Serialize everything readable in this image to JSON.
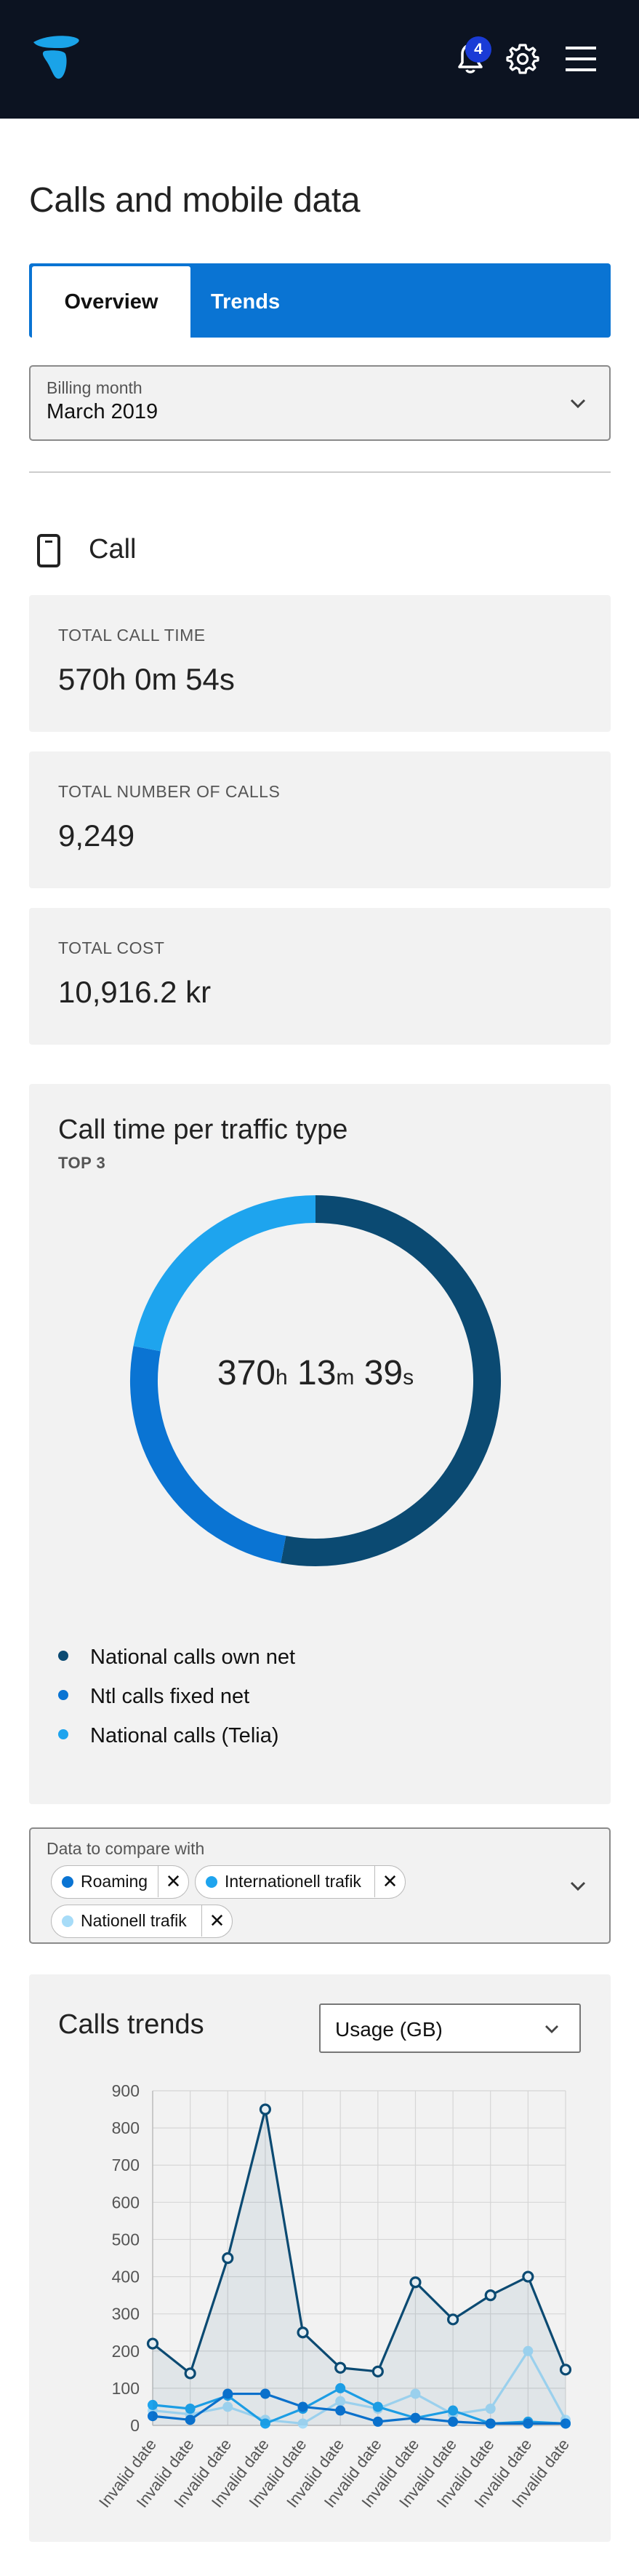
{
  "header": {
    "logo_icon": "telia-pebble-logo-icon",
    "notification_count": "4",
    "icons": [
      "bell-icon",
      "gear-icon",
      "hamburger-menu-icon"
    ],
    "colors": {
      "background": "#0c1321",
      "badge": "#1a3bd6",
      "logo": "#1aa3e8"
    }
  },
  "page": {
    "title": "Calls and mobile data"
  },
  "tabs": [
    {
      "label": "Overview",
      "active": true
    },
    {
      "label": "Trends",
      "active": false
    }
  ],
  "billing": {
    "label": "Billing month",
    "value": "March 2019"
  },
  "call_section": {
    "title": "Call",
    "icon": "mobile-phone-icon"
  },
  "stats": [
    {
      "label": "TOTAL CALL TIME",
      "value": "570h 0m 54s"
    },
    {
      "label": "TOTAL NUMBER OF CALLS",
      "value": "9,249"
    },
    {
      "label": "TOTAL COST",
      "value": "10,916.2 kr"
    }
  ],
  "traffic_panel": {
    "title": "Call time per traffic type",
    "subtitle": "TOP 3",
    "center": {
      "h": "370",
      "h_unit": "h",
      "m": "13",
      "m_unit": "m",
      "s": "39",
      "s_unit": "s"
    },
    "legend": [
      {
        "label": "National calls own net",
        "color": "#0b4a72"
      },
      {
        "label": "Ntl calls fixed net",
        "color": "#0a74d3"
      },
      {
        "label": "National calls (Telia)",
        "color": "#1ea4ee"
      }
    ]
  },
  "compare": {
    "label": "Data to compare with",
    "chips": [
      {
        "label": "Roaming",
        "color": "#0a74d3"
      },
      {
        "label": "Internationell trafik",
        "color": "#1ea4ee"
      },
      {
        "label": "Nationell trafik",
        "color": "#a7dcf8"
      }
    ]
  },
  "trends_panel": {
    "title": "Calls trends",
    "select_value": "Usage (GB)"
  },
  "chart_data": [
    {
      "type": "pie",
      "categories": [
        "National calls own net",
        "Ntl calls fixed net",
        "National calls (Telia)"
      ],
      "values": [
        0.53,
        0.25,
        0.22
      ],
      "colors": [
        "#0b4a72",
        "#0a74d3",
        "#1ea4ee"
      ],
      "title": "Call time per traffic type",
      "subtitle": "TOP 3"
    },
    {
      "type": "line",
      "title": "Calls trends",
      "categories": [
        "Invalid date",
        "Invalid date",
        "Invalid date",
        "Invalid date",
        "Invalid date",
        "Invalid date",
        "Invalid date",
        "Invalid date",
        "Invalid date",
        "Invalid date",
        "Invalid date",
        "Invalid date"
      ],
      "yticks": [
        0,
        100,
        200,
        300,
        400,
        500,
        600,
        700,
        800,
        900
      ],
      "ylim": [
        0,
        900
      ],
      "grid": true,
      "series": [
        {
          "values": [
            220,
            140,
            450,
            850,
            250,
            155,
            145,
            385,
            285,
            350,
            400,
            150
          ],
          "color": "#0b4a72",
          "fill": true,
          "hollow": true
        },
        {
          "name": "Roaming",
          "values": [
            25,
            15,
            85,
            85,
            50,
            40,
            10,
            20,
            10,
            5,
            5,
            5
          ],
          "color": "#0a74d3"
        },
        {
          "name": "Internationell trafik",
          "values": [
            55,
            45,
            80,
            5,
            45,
            100,
            50,
            20,
            40,
            5,
            10,
            5
          ],
          "color": "#1ea4ee"
        },
        {
          "name": "Nationell trafik",
          "values": [
            40,
            30,
            50,
            15,
            5,
            65,
            45,
            85,
            30,
            45,
            200,
            15
          ],
          "color": "#a7dcf8"
        }
      ]
    }
  ]
}
